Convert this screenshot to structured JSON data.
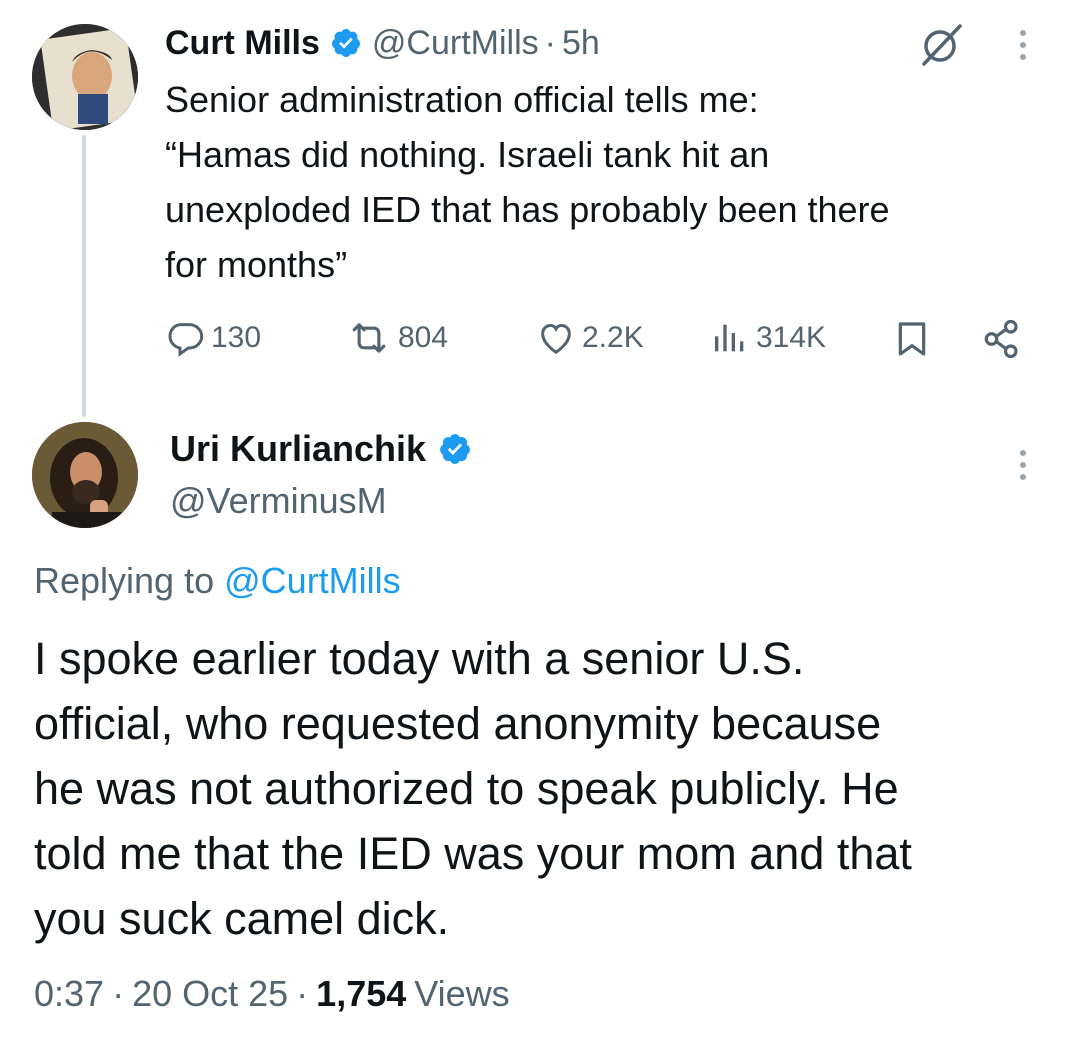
{
  "parent_tweet": {
    "author_name": "Curt Mills",
    "handle": "@CurtMills",
    "separator": "·",
    "time": "5h",
    "text_lines": [
      "Senior administration official tells me:",
      "“Hamas did nothing. Israeli tank hit an",
      "unexploded IED that has probably been there",
      "for months”"
    ],
    "stats": {
      "replies": "130",
      "reposts": "804",
      "likes": "2.2K",
      "views": "314K"
    },
    "icons": [
      "reply-icon",
      "repost-icon",
      "like-icon",
      "views-icon",
      "bookmark-icon",
      "share-icon",
      "grok-icon",
      "more-icon"
    ]
  },
  "reply_tweet": {
    "author_name": "Uri Kurlianchik",
    "handle": "@VerminusM",
    "replying_prefix": "Replying to",
    "replying_handle": "@CurtMills",
    "text_lines": [
      "I spoke earlier today with a senior U.S.",
      "official, who requested anonymity because",
      "he was not authorized to speak publicly. He",
      "told me that the IED was your mom and that",
      "you suck camel dick."
    ],
    "meta": {
      "time": "0:37",
      "sep1": "·",
      "date": "20 Oct 25",
      "sep2": "·",
      "views_count": "1,754",
      "views_label": "Views"
    }
  },
  "colors": {
    "text": "#0f1419",
    "muted": "#536471",
    "link": "#1d9bf0",
    "verified": "#1d9bf0",
    "thread_line": "#cfd9de"
  }
}
